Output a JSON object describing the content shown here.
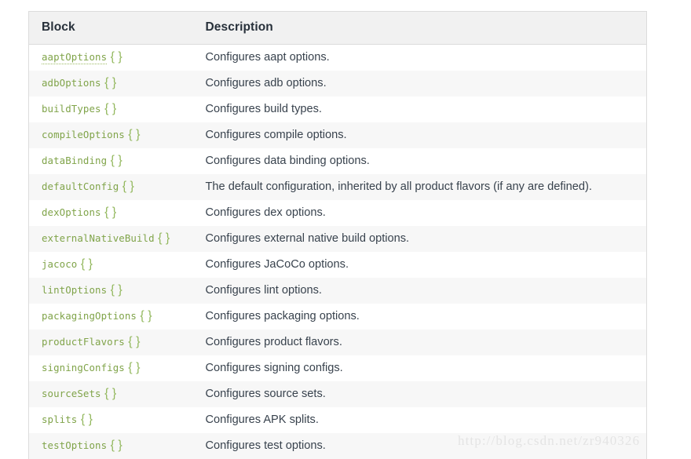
{
  "table": {
    "columns": [
      {
        "key": "block",
        "label": "Block"
      },
      {
        "key": "description",
        "label": "Description"
      }
    ],
    "rows": [
      {
        "block": "aaptOptions",
        "braces": "{ }",
        "linked": true,
        "description": "Configures aapt options."
      },
      {
        "block": "adbOptions",
        "braces": "{ }",
        "linked": false,
        "description": "Configures adb options."
      },
      {
        "block": "buildTypes",
        "braces": "{ }",
        "linked": false,
        "description": "Configures build types."
      },
      {
        "block": "compileOptions",
        "braces": "{ }",
        "linked": false,
        "description": "Configures compile options."
      },
      {
        "block": "dataBinding",
        "braces": "{ }",
        "linked": false,
        "description": "Configures data binding options."
      },
      {
        "block": "defaultConfig",
        "braces": "{ }",
        "linked": false,
        "description": "The default configuration, inherited by all product flavors (if any are defined)."
      },
      {
        "block": "dexOptions",
        "braces": "{ }",
        "linked": false,
        "description": "Configures dex options."
      },
      {
        "block": "externalNativeBuild",
        "braces": "{ }",
        "linked": false,
        "description": "Configures external native build options."
      },
      {
        "block": "jacoco",
        "braces": "{ }",
        "linked": false,
        "description": "Configures JaCoCo options."
      },
      {
        "block": "lintOptions",
        "braces": "{ }",
        "linked": false,
        "description": "Configures lint options."
      },
      {
        "block": "packagingOptions",
        "braces": "{ }",
        "linked": false,
        "description": "Configures packaging options."
      },
      {
        "block": "productFlavors",
        "braces": "{ }",
        "linked": false,
        "description": "Configures product flavors."
      },
      {
        "block": "signingConfigs",
        "braces": "{ }",
        "linked": false,
        "description": "Configures signing configs."
      },
      {
        "block": "sourceSets",
        "braces": "{ }",
        "linked": false,
        "description": "Configures source sets."
      },
      {
        "block": "splits",
        "braces": "{ }",
        "linked": false,
        "description": "Configures APK splits."
      },
      {
        "block": "testOptions",
        "braces": "{ }",
        "linked": false,
        "description": "Configures test options."
      }
    ]
  },
  "watermark": {
    "text": "http://blog.csdn.net/zr940326"
  },
  "colors": {
    "code_green": "#80a44a",
    "brace_green": "#93b85e",
    "header_bg": "#f1f1f1",
    "stripe_bg": "#f7f7f7",
    "border": "#dcdcdc",
    "description_text": "#38424d",
    "header_text": "#27303a",
    "watermark_text": "#e4e4e4"
  }
}
